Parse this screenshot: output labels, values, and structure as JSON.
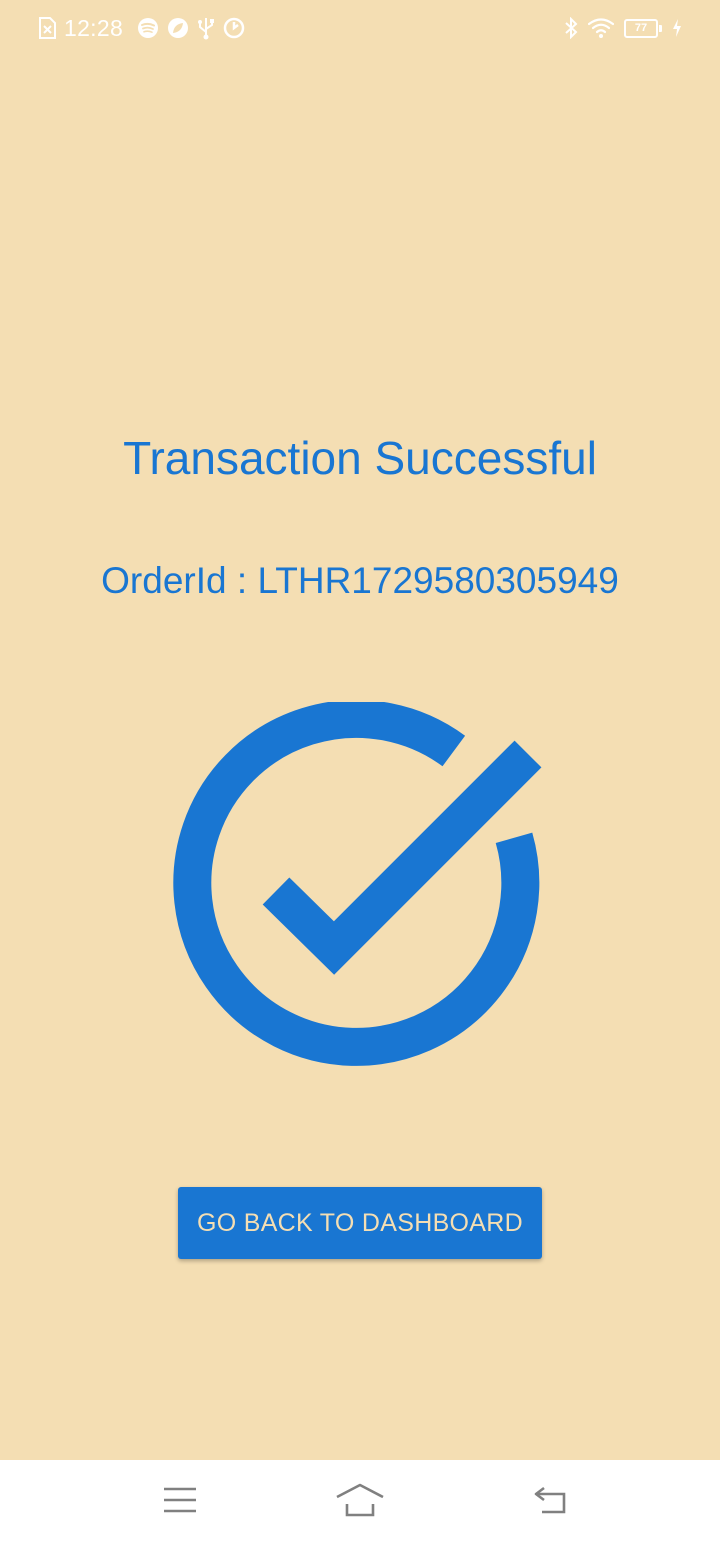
{
  "status_bar": {
    "time": "12:28",
    "battery_level": "77",
    "left_icons": [
      "file-x-icon",
      "spotify-icon",
      "leaf-app-icon",
      "usb-icon",
      "sync-app-icon"
    ],
    "right_icons": [
      "bluetooth-icon",
      "wifi-icon",
      "battery-icon",
      "charging-icon"
    ]
  },
  "main": {
    "title": "Transaction Successful",
    "order_label": "OrderId : ",
    "order_id": "LTHR1729580305949",
    "status_icon": "check-circle-icon",
    "button_label": "GO BACK TO DASHBOARD"
  },
  "nav_bar": {
    "icons": [
      "menu-icon",
      "home-icon",
      "back-icon"
    ]
  },
  "colors": {
    "background": "#f4deb3",
    "accent": "#1976d2",
    "nav_background": "#ffffff",
    "nav_icon": "#808080"
  }
}
